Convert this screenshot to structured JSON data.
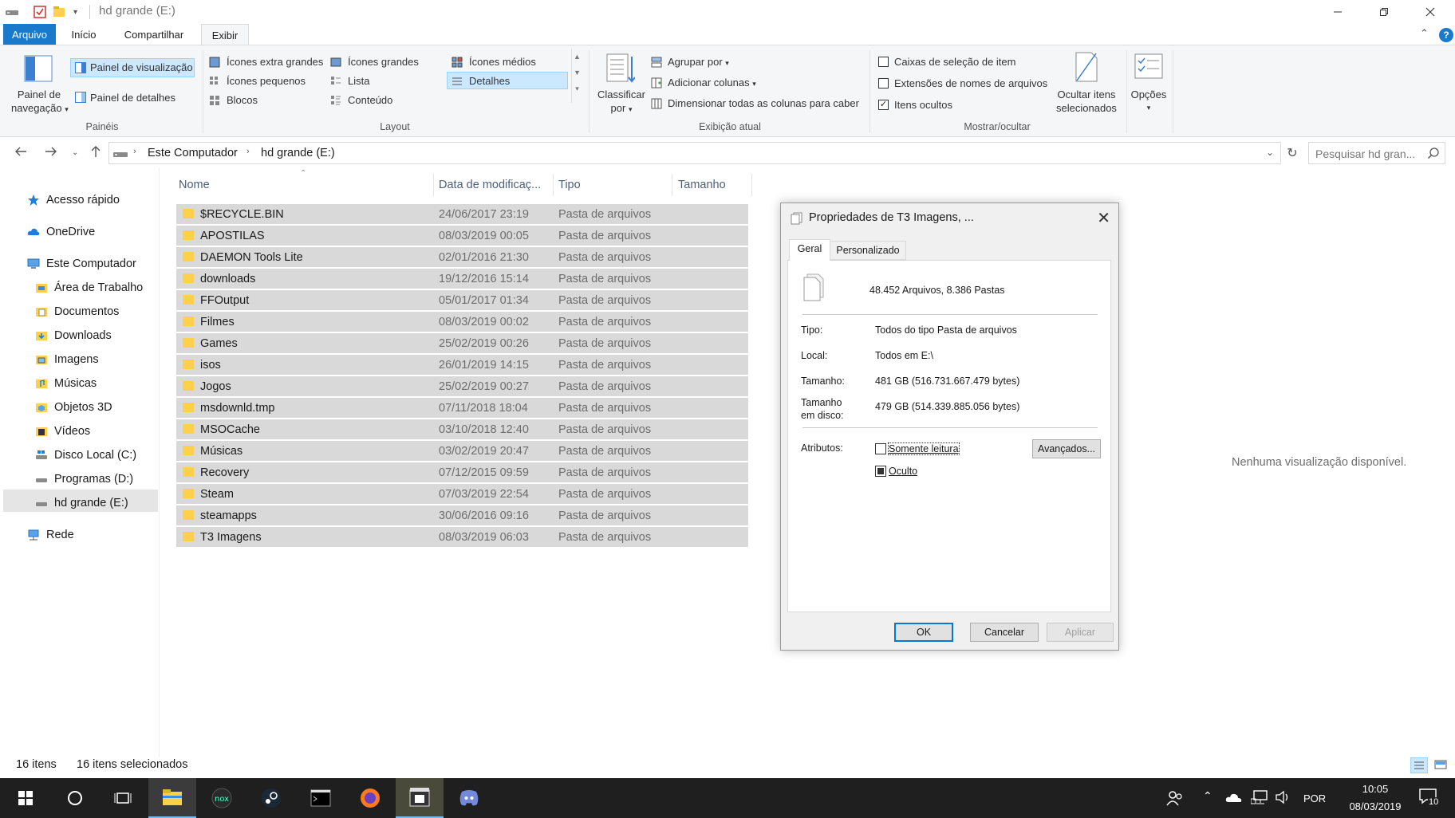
{
  "window": {
    "title": "hd grande (E:)"
  },
  "tabs": {
    "file": "Arquivo",
    "home": "Início",
    "share": "Compartilhar",
    "view": "Exibir"
  },
  "ribbon": {
    "panes": {
      "nav_pane": "Painel de navegação",
      "nav_pane_l1": "Painel de",
      "nav_pane_l2": "navegação",
      "preview_pane": "Painel de visualização",
      "details_pane": "Painel de detalhes",
      "label": "Painéis"
    },
    "layout": {
      "extra_large": "Ícones extra grandes",
      "large": "Ícones grandes",
      "medium": "Ícones médios",
      "small": "Ícones pequenos",
      "list": "Lista",
      "details": "Detalhes",
      "tiles": "Blocos",
      "content": "Conteúdo",
      "label": "Layout"
    },
    "current_view": {
      "sort_l1": "Classificar",
      "sort_l2": "por",
      "group_by": "Agrupar por",
      "add_columns": "Adicionar colunas",
      "size_columns": "Dimensionar todas as colunas para caber",
      "label": "Exibição atual"
    },
    "show_hide": {
      "item_checkboxes": "Caixas de seleção de item",
      "extensions": "Extensões de nomes de arquivos",
      "hidden_items": "Itens ocultos",
      "hide_selected_l1": "Ocultar itens",
      "hide_selected_l2": "selecionados",
      "options": "Opções",
      "label": "Mostrar/ocultar"
    }
  },
  "address": {
    "crumb1": "Este Computador",
    "crumb2": "hd grande (E:)",
    "search_placeholder": "Pesquisar hd gran..."
  },
  "sidebar": {
    "quick_access": "Acesso rápido",
    "onedrive": "OneDrive",
    "this_pc": "Este Computador",
    "desktop": "Área de Trabalho",
    "documents": "Documentos",
    "downloads": "Downloads",
    "images": "Imagens",
    "music": "Músicas",
    "objects3d": "Objetos 3D",
    "videos": "Vídeos",
    "disk_c": "Disco Local (C:)",
    "disk_d": "Programas (D:)",
    "disk_e": "hd grande (E:)",
    "network": "Rede"
  },
  "columns": {
    "name": "Nome",
    "date": "Data de modificaç...",
    "type": "Tipo",
    "size": "Tamanho"
  },
  "files": [
    {
      "name": "$RECYCLE.BIN",
      "date": "24/06/2017 23:19",
      "type": "Pasta de arquivos"
    },
    {
      "name": "APOSTILAS",
      "date": "08/03/2019 00:05",
      "type": "Pasta de arquivos"
    },
    {
      "name": "DAEMON Tools Lite",
      "date": "02/01/2016 21:30",
      "type": "Pasta de arquivos"
    },
    {
      "name": "downloads",
      "date": "19/12/2016 15:14",
      "type": "Pasta de arquivos"
    },
    {
      "name": "FFOutput",
      "date": "05/01/2017 01:34",
      "type": "Pasta de arquivos"
    },
    {
      "name": "Filmes",
      "date": "08/03/2019 00:02",
      "type": "Pasta de arquivos"
    },
    {
      "name": "Games",
      "date": "25/02/2019 00:26",
      "type": "Pasta de arquivos"
    },
    {
      "name": "isos",
      "date": "26/01/2019 14:15",
      "type": "Pasta de arquivos"
    },
    {
      "name": "Jogos",
      "date": "25/02/2019 00:27",
      "type": "Pasta de arquivos"
    },
    {
      "name": "msdownld.tmp",
      "date": "07/11/2018 18:04",
      "type": "Pasta de arquivos"
    },
    {
      "name": "MSOCache",
      "date": "03/10/2018 12:40",
      "type": "Pasta de arquivos"
    },
    {
      "name": "Músicas",
      "date": "03/02/2019 20:47",
      "type": "Pasta de arquivos"
    },
    {
      "name": "Recovery",
      "date": "07/12/2015 09:59",
      "type": "Pasta de arquivos"
    },
    {
      "name": "Steam",
      "date": "07/03/2019 22:54",
      "type": "Pasta de arquivos"
    },
    {
      "name": "steamapps",
      "date": "30/06/2016 09:16",
      "type": "Pasta de arquivos"
    },
    {
      "name": "T3 Imagens",
      "date": "08/03/2019 06:03",
      "type": "Pasta de arquivos"
    }
  ],
  "preview": {
    "message": "Nenhuma visualização disponível."
  },
  "status": {
    "count": "16 itens",
    "selected": "16 itens selecionados"
  },
  "dialog": {
    "title": "Propriedades de T3 Imagens, ...",
    "tab_general": "Geral",
    "tab_custom": "Personalizado",
    "summary": "48.452 Arquivos, 8.386 Pastas",
    "type_label": "Tipo:",
    "type_value": "Todos do tipo Pasta de arquivos",
    "location_label": "Local:",
    "location_value": "Todos em E:\\",
    "size_label": "Tamanho:",
    "size_value": "481 GB (516.731.667.479 bytes)",
    "disk_size_l1": "Tamanho",
    "disk_size_l2": "em disco:",
    "disk_size_value": "479 GB (514.339.885.056 bytes)",
    "attributes_label": "Atributos:",
    "readonly_label": "Somente leitura",
    "hidden_label": "Oculto",
    "advanced_button": "Avançados...",
    "ok": "OK",
    "cancel": "Cancelar",
    "apply": "Aplicar"
  },
  "taskbar": {
    "language": "POR",
    "time": "10:05",
    "date": "08/03/2019",
    "notifications": "10"
  },
  "colors": {
    "accent": "#1979ca",
    "selection": "#cce8ff",
    "row_selected": "#d9d9d9",
    "taskbar": "#1f1f1f"
  }
}
